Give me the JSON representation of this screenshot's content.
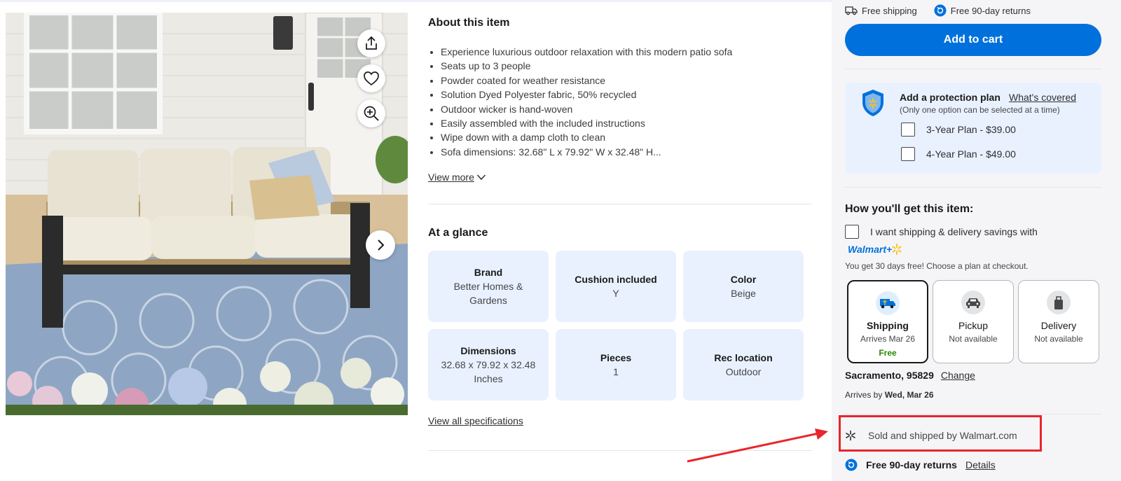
{
  "gallery": {
    "share_icon": "share-icon",
    "favorite_icon": "heart-icon",
    "zoom_icon": "zoom-in-icon",
    "next_icon": "chevron-right-icon"
  },
  "about": {
    "title": "About this item",
    "bullets": [
      "Experience luxurious outdoor relaxation with this modern patio sofa",
      "Seats up to 3 people",
      "Powder coated for weather resistance",
      "Solution Dyed Polyester fabric, 50% recycled",
      "Outdoor wicker is hand-woven",
      "Easily assembled with the included instructions",
      "Wipe down with a damp cloth to clean",
      "Sofa dimensions: 32.68\" L x 79.92\" W x 32.48\" H..."
    ],
    "view_more": "View more"
  },
  "glance": {
    "title": "At a glance",
    "tiles": [
      {
        "label": "Brand",
        "value": "Better Homes & Gardens"
      },
      {
        "label": "Cushion included",
        "value": "Y"
      },
      {
        "label": "Color",
        "value": "Beige"
      },
      {
        "label": "Dimensions",
        "value": "32.68 x 79.92 x 32.48 Inches"
      },
      {
        "label": "Pieces",
        "value": "1"
      },
      {
        "label": "Rec location",
        "value": "Outdoor"
      }
    ],
    "view_all": "View all specifications"
  },
  "buybox": {
    "free_shipping": "Free shipping",
    "free_returns": "Free 90-day returns",
    "add_to_cart": "Add to cart",
    "accent_color": "#0071dc",
    "protection": {
      "title": "Add a protection plan",
      "link": "What's covered",
      "subtitle": "(Only one option can be selected at a time)",
      "options": [
        "3-Year Plan - $39.00",
        "4-Year Plan - $49.00"
      ]
    },
    "how_title": "How you'll get this item:",
    "walmart_plus_label": "I want shipping & delivery savings with",
    "walmart_plus_logo": "Walmart+",
    "trial": "You get 30 days free! Choose a plan at checkout.",
    "fulfillment": [
      {
        "name": "Shipping",
        "sub": "Arrives Mar 26",
        "note": "Free",
        "icon": "delivery-truck-icon"
      },
      {
        "name": "Pickup",
        "sub": "Not available",
        "icon": "car-icon"
      },
      {
        "name": "Delivery",
        "sub": "Not available",
        "icon": "delivery-bag-icon"
      }
    ],
    "location": "Sacramento, 95829",
    "change": "Change",
    "arrives_prefix": "Arrives by",
    "arrives_date": "Wed, Mar 26",
    "sold_by": "Sold and shipped by Walmart.com",
    "returns_label": "Free 90-day returns",
    "details": "Details"
  }
}
